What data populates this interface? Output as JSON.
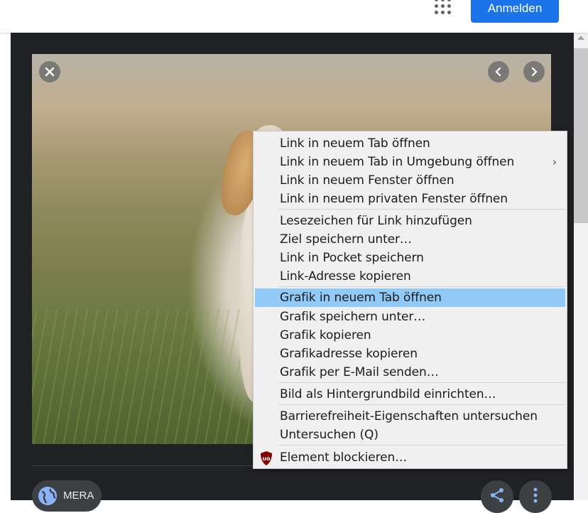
{
  "header": {
    "apps_icon": "grid-apps-icon",
    "signin_label": "Anmelden"
  },
  "viewer": {
    "close_icon": "close-icon",
    "prev_icon": "chevron-left-icon",
    "next_icon": "chevron-right-icon",
    "source_chip_label": "MERA",
    "source_icon": "globe-icon",
    "share_icon": "share-icon",
    "more_icon": "more-vert-icon"
  },
  "context_menu": {
    "items": [
      {
        "label": "Link in neuem Tab öffnen"
      },
      {
        "label": "Link in neuem Tab in Umgebung öffnen",
        "submenu": "›"
      },
      {
        "label": "Link in neuem Fenster öffnen"
      },
      {
        "label": "Link in neuem privaten Fenster öffnen"
      },
      {
        "label": "Lesezeichen für Link hinzufügen"
      },
      {
        "label": "Ziel speichern unter…"
      },
      {
        "label": "Link in Pocket speichern"
      },
      {
        "label": "Link-Adresse kopieren"
      },
      {
        "label": "Grafik in neuem Tab öffnen"
      },
      {
        "label": "Grafik speichern unter…"
      },
      {
        "label": "Grafik kopieren"
      },
      {
        "label": "Grafikadresse kopieren"
      },
      {
        "label": "Grafik per E-Mail senden…"
      },
      {
        "label": "Bild als Hintergrundbild einrichten…"
      },
      {
        "label": "Barrierefreiheit-Eigenschaften untersuchen"
      },
      {
        "label": "Untersuchen (Q)"
      },
      {
        "label": "Element blockieren…",
        "icon": "ublock-origin-icon"
      }
    ],
    "highlighted_index": 8,
    "highlight_color": "#91c9f7"
  },
  "colors": {
    "accent": "#1a73e8",
    "dark_panel": "#202124"
  }
}
